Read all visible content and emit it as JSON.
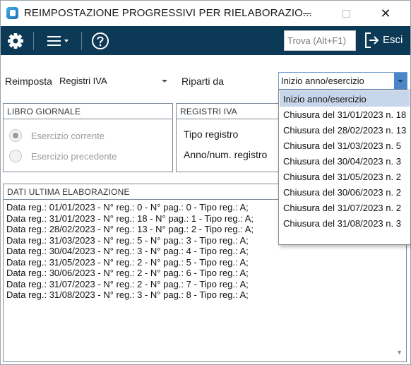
{
  "window": {
    "title": "REIMPOSTAZIONE PROGRESSIVI PER RIELABORAZIO...",
    "minimize_label": "",
    "maximize_label": "",
    "close_label": "✕"
  },
  "toolbar": {
    "search_placeholder": "Trova (Alt+F1)",
    "exit_label": "Esci",
    "colors": {
      "background": "#0c3a56",
      "icon": "#ffffff"
    }
  },
  "form": {
    "reimposta_label": "Reimposta",
    "reimposta_value": "Registri IVA",
    "riparti_label": "Riparti da",
    "riparti_value": "Inizio anno/esercizio"
  },
  "libro_giornale": {
    "title": "LIBRO GIORNALE",
    "options": [
      {
        "label": "Esercizio corrente",
        "checked": true
      },
      {
        "label": "Esercizio precedente",
        "checked": false
      }
    ]
  },
  "registri_iva": {
    "title": "REGISTRI IVA",
    "fields": [
      "Tipo registro",
      "Anno/num. registro"
    ]
  },
  "dati_ultima": {
    "title": "DATI ULTIMA ELABORAZIONE",
    "lines": [
      "Data reg.: 01/01/2023 - N° reg.: 0 - N° pag.: 0 - Tipo reg.: A;",
      "Data reg.: 31/01/2023 - N° reg.: 18 - N° pag.: 1 - Tipo reg.: A;",
      "Data reg.: 28/02/2023 - N° reg.: 13 - N° pag.: 2 - Tipo reg.: A;",
      "Data reg.: 31/03/2023 - N° reg.: 5 - N° pag.: 3 - Tipo reg.: A;",
      "Data reg.: 30/04/2023 - N° reg.: 3 - N° pag.: 4 - Tipo reg.: A;",
      "Data reg.: 31/05/2023 - N° reg.: 2 - N° pag.: 5 - Tipo reg.: A;",
      "Data reg.: 30/06/2023 - N° reg.: 2 - N° pag.: 6 - Tipo reg.: A;",
      "Data reg.: 31/07/2023 - N° reg.: 2 - N° pag.: 7 - Tipo reg.: A;",
      "Data reg.: 31/08/2023 - N° reg.: 3 - N° pag.: 8 - Tipo reg.: A;"
    ]
  },
  "dropdown": {
    "items": [
      {
        "label": "Inizio anno/esercizio",
        "selected": true
      },
      {
        "label": "Chiusura del 31/01/2023 n. 18",
        "selected": false
      },
      {
        "label": "Chiusura del 28/02/2023 n. 13",
        "selected": false
      },
      {
        "label": "Chiusura del 31/03/2023 n. 5",
        "selected": false
      },
      {
        "label": "Chiusura del 30/04/2023 n. 3",
        "selected": false
      },
      {
        "label": "Chiusura del 31/05/2023 n. 2",
        "selected": false
      },
      {
        "label": "Chiusura del 30/06/2023 n. 2",
        "selected": false
      },
      {
        "label": "Chiusura del 31/07/2023 n. 2",
        "selected": false
      },
      {
        "label": "Chiusura del 31/08/2023 n. 3",
        "selected": false
      }
    ]
  }
}
